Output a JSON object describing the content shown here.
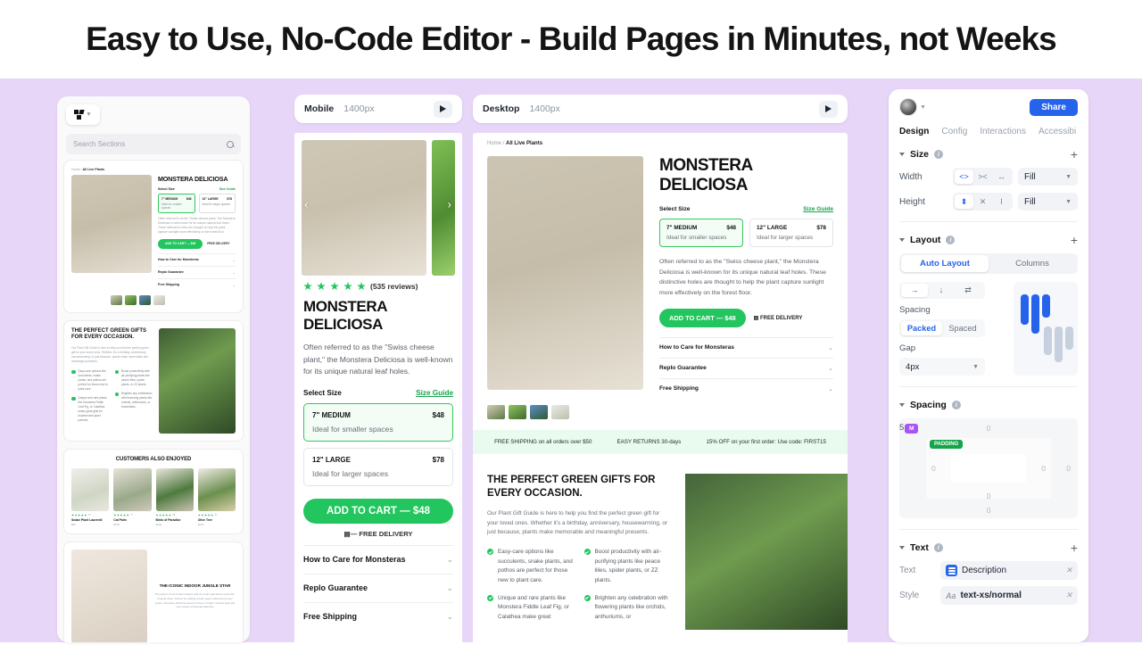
{
  "headline": "Easy to Use, No-Code Editor - Build Pages in Minutes, not Weeks",
  "theme": {
    "canvas_bg": "#e7d6f8",
    "accent_green": "#22c55e",
    "accent_blue": "#2563eb",
    "purple": "#a855f7"
  },
  "left_panel": {
    "logo_icon": "replo-logo-icon",
    "search": {
      "placeholder": "Search Sections",
      "icon": "search-icon"
    },
    "sections": [
      {
        "type": "pdp",
        "breadcrumb_home": "Home /",
        "breadcrumb_current": "All Live Plants",
        "title": "MONSTERA DELICIOSA",
        "select_size": "Select Size",
        "size_guide": "Size Guide",
        "sizes": [
          {
            "name": "7\" MEDIUM",
            "price": "$48",
            "sub": "Ideal for smaller spaces",
            "selected": true
          },
          {
            "name": "12\" LARGE",
            "price": "$78",
            "sub": "Ideal for larger spaces",
            "selected": false
          }
        ],
        "description": "Often referred to as the \"Swiss cheese plant,\" the Monstera Deliciosa is well-known for its unique natural leaf holes. These distinctive holes are thought to help the plant capture sunlight more effectively on the forest floor.",
        "cta": "ADD TO CART — $48",
        "free_delivery": "FREE DELIVERY",
        "accordions": [
          "How to Care for Monsteras",
          "Replo Guarantee",
          "Free Shipping"
        ]
      },
      {
        "type": "gifts",
        "title": "THE PERFECT GREEN GIFTS FOR EVERY OCCASION.",
        "paragraph": "Our Plant Gift Guide is here to help you find the perfect green gift for your loved ones. Whether it's a birthday, anniversary, housewarming, or just because, plants make memorable and meaningful presents.",
        "bullets": [
          "Easy-care options like succulents, snake plants, and pothos are perfect for those new to plant care.",
          "Boost productivity with air-purifying plants like peace lilies, spider plants, or ZZ plants.",
          "Unique and rare plants like Monstera Fiddle Leaf Fig, or Calathea make great gifts for experienced plant parents.",
          "Brighten any celebration with flowering plants like orchids, anthuriums, or bromeliads."
        ]
      },
      {
        "type": "also_enjoyed",
        "title": "CUSTOMERS ALSO ENJOYED",
        "products": [
          {
            "name": "Snake Plant Laurentii",
            "price": "$60",
            "stars": 5,
            "count": "97"
          },
          {
            "name": "Cat Palm",
            "price": "$129",
            "stars": 5,
            "count": "77"
          },
          {
            "name": "Birds of Paradise",
            "price": "$169",
            "stars": 5,
            "count": "88"
          },
          {
            "name": "Olive Tree",
            "price": "$142",
            "stars": 5,
            "count": "67"
          }
        ]
      },
      {
        "type": "iconic",
        "title": "THE ICONIC INDOOR JUNGLE STAR",
        "paragraph": "The plant's iconic broken leaves with its exotic split leaves and lush, tropical vibes. Perfect for adding a bold, green statement to any space. Monstera Deliciosa leaves thrives in bright, indirect light and only needs occasional watering."
      }
    ]
  },
  "mobile_frame": {
    "device": "Mobile",
    "width_label": "1400px",
    "play_icon": "play-icon",
    "prev_icon": "chevron-left-icon",
    "next_icon": "chevron-right-icon",
    "reviews": "(535 reviews)",
    "stars": 5,
    "title": "MONSTERA DELICIOSA",
    "description": "Often referred to as the \"Swiss cheese plant,\" the Monstera Deliciosa is well-known for its unique natural leaf holes.",
    "select_size": "Select Size",
    "size_guide": "Size Guide",
    "sizes": [
      {
        "name": "7\" MEDIUM",
        "price": "$48",
        "sub": "Ideal for smaller spaces",
        "selected": true
      },
      {
        "name": "12\" LARGE",
        "price": "$78",
        "sub": "Ideal for larger spaces",
        "selected": false
      }
    ],
    "cta": "ADD TO CART — $48",
    "free_delivery": "FREE DELIVERY",
    "accordions": [
      "How to Care for Monsteras",
      "Replo Guarantee",
      "Free Shipping"
    ]
  },
  "desktop_frame": {
    "device": "Desktop",
    "width_label": "1400px",
    "play_icon": "play-icon",
    "breadcrumb_home": "Home",
    "breadcrumb_sep": "/",
    "breadcrumb_current": "All Live Plants",
    "title": "MONSTERA DELICIOSA",
    "select_size": "Select Size",
    "size_guide": "Size Guide",
    "sizes": [
      {
        "name": "7\" MEDIUM",
        "price": "$48",
        "sub": "Ideal for smaller spaces",
        "selected": true
      },
      {
        "name": "12\" LARGE",
        "price": "$78",
        "sub": "Ideal for larger spaces",
        "selected": false
      }
    ],
    "description": "Often referred to as the \"Swiss cheese plant,\" the Monstera Deliciosa is well-known for its unique natural leaf holes. These distinctive holes are thought to help the plant capture sunlight more effectively on the forest floor.",
    "cta": "ADD TO CART — $48",
    "free_delivery": "FREE DELIVERY",
    "accordions": [
      "How to Care for Monsteras",
      "Replo Guarantee",
      "Free Shipping"
    ],
    "promos": [
      "FREE SHIPPING on all orders over $50",
      "EASY RETURNS 30-days",
      "15% OFF on your first order: Use code: FIRST15"
    ],
    "gifts": {
      "title": "THE PERFECT GREEN GIFTS FOR EVERY OCCASION.",
      "paragraph": "Our Plant Gift Guide is here to help you find the perfect green gift for your loved ones. Whether it's a birthday, anniversary, housewarming, or just because, plants make memorable and meaningful presents.",
      "bullets": [
        "Easy-care options like succulents, snake plants, and pothos are perfect for those new to plant care.",
        "Boost productivity with air-purifying plants like peace lilies, spider plants, or ZZ plants.",
        "Unique and rare plants like Monstera Fiddle Leaf Fig, or Calathea make great",
        "Brighten any celebration with flowering plants like orchids, anthuriums, or"
      ]
    }
  },
  "right_panel": {
    "avatar_icon": "user-avatar",
    "avatar_chevron": "chevron-down-icon",
    "share_label": "Share",
    "tabs": [
      {
        "label": "Design",
        "active": true
      },
      {
        "label": "Config",
        "active": false
      },
      {
        "label": "Interactions",
        "active": false
      },
      {
        "label": "Accessibi",
        "active": false
      }
    ],
    "size": {
      "title": "Size",
      "info_icon": "info-icon",
      "add_icon": "plus-icon",
      "width_label": "Width",
      "width_value": "Fill",
      "height_label": "Height",
      "height_value": "Fill",
      "width_modes": [
        "<>",
        "><",
        "↔"
      ],
      "height_modes": [
        "⬍",
        "✕",
        "I"
      ]
    },
    "layout": {
      "title": "Layout",
      "info_icon": "info-icon",
      "add_icon": "plus-icon",
      "tabs": [
        {
          "label": "Auto Layout",
          "active": true
        },
        {
          "label": "Columns",
          "active": false
        }
      ],
      "directions": [
        "→",
        "↓",
        "⇄"
      ],
      "spacing_label": "Spacing",
      "packing": [
        {
          "label": "Packed",
          "active": true
        },
        {
          "label": "Spaced",
          "active": false
        }
      ],
      "gap_label": "Gap",
      "gap_value": "4px"
    },
    "spacing": {
      "title": "Spacing",
      "info_icon": "info-icon",
      "margin_badge": "M",
      "padding_badge": "PADDING",
      "margin_left_value": "5px",
      "zero_values": [
        "0",
        "0",
        "0",
        "0",
        "0",
        "0",
        "0"
      ]
    },
    "text": {
      "title": "Text",
      "info_icon": "info-icon",
      "add_icon": "plus-icon",
      "text_label": "Text",
      "text_value": "Description",
      "text_icon": "text-layers-icon",
      "style_label": "Style",
      "style_value": "text-xs/normal",
      "style_icon": "font-aa-icon",
      "clear_icon": "close-icon"
    }
  }
}
